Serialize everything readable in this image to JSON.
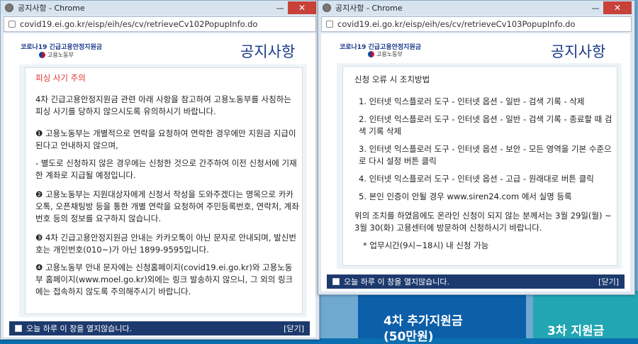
{
  "window_left": {
    "title": "공지사항 - Chrome",
    "url": "covid19.ei.go.kr/eisp/eih/es/cv/retrieveCv102PopupInfo.do",
    "logo_title": "코로나19 긴급고용안정지원금",
    "logo_ministry": "고용노동부",
    "notice_title": "공지사항",
    "heading": "피싱 사기 주의",
    "paragraphs": [
      "4차 긴급고용안정지원금 관련 아래 사항을 참고하여 고용노동부를 사칭하는 피싱 사기를 당하지 않으시도록 유의하시기 바랍니다.",
      "❶ 고용노동부는 개별적으로 연락을 요청하여 연락한 경우에만 지원금 지급이 된다고 안내하지 않으며,",
      "- 별도로 신청하지 않은 경우에는 신청한 것으로 간주하여 이전 신청서에 기재한 계좌로 지급될 예정입니다.",
      "❷ 고용노동부는 지원대상자에게 신청서 작성을 도와주겠다는 명목으로 카카오톡, 오픈채팅방 등을 통한 개별 연락을 요청하여 주민등록번호, 연락처, 계좌번호 등의 정보를 요구하지 않습니다.",
      "❸ 4차 긴급고용안정지원금 안내는 카카오톡이 아닌 문자로 안내되며, 발신번호는 개인번호(010~)가 아닌 1899-9595입니다.",
      "❹ 고용노동부 안내 문자에는 신청홈페이지(covid19.ei.go.kr)와 고용노동부 홈페이지(www.moel.go.kr)외에는 링크 발송하지 않으니, 그 외의 링크에는 접속하지 않도록 주의해주시기 바랍니다."
    ],
    "footer_text": "오늘 하루 이 창을 열지않습니다.",
    "close_link": "[닫기]"
  },
  "window_right": {
    "title": "공지사항 - Chrome",
    "url": "covid19.ei.go.kr/eisp/eih/es/cv/retrieveCv103PopupInfo.do",
    "logo_title": "코로나19 긴급고용안정지원금",
    "logo_ministry": "고용노동부",
    "notice_title": "공지사항",
    "heading": "신청 오류 시 조치방법",
    "steps": [
      "1. 인터넷 익스플로러 도구 - 인터넷 옵션 - 일반 - 검색 기록 - 삭제",
      "2. 인터넷 익스플로러 도구 - 인터넷 옵션 - 일반 - 검색 기록 - 종료할 때 검색 기록 삭제",
      "3. 인터넷 익스플로러 도구 - 인터넷 옵션 - 보안 - 모든 영역을 기본 수준으로 다시 설정 버튼 클릭",
      "4. 인터넷 익스플로러 도구 - 인터넷 옵션 - 고급 - 원래대로 버튼 클릭",
      "5. 본인 인증이 안될 경우 www.siren24.com 에서 실명 등록"
    ],
    "note": "위의 조치를 하였음에도 온라인 신청이 되지 않는 분께서는 3월 29일(월) ~ 3월 30(화) 고용센터에 방문하여 신청하시기 바랍니다.",
    "hours": "* 업무시간(9시~18시) 내 신청 가능",
    "footer_text": "오늘 하루 이 창을 열지않습니다.",
    "close_link": "[닫기]"
  },
  "background": {
    "card1_line1": "4차 추가지원금",
    "card1_line2": "(50만원)",
    "card2_line1": "3차 지원금"
  }
}
